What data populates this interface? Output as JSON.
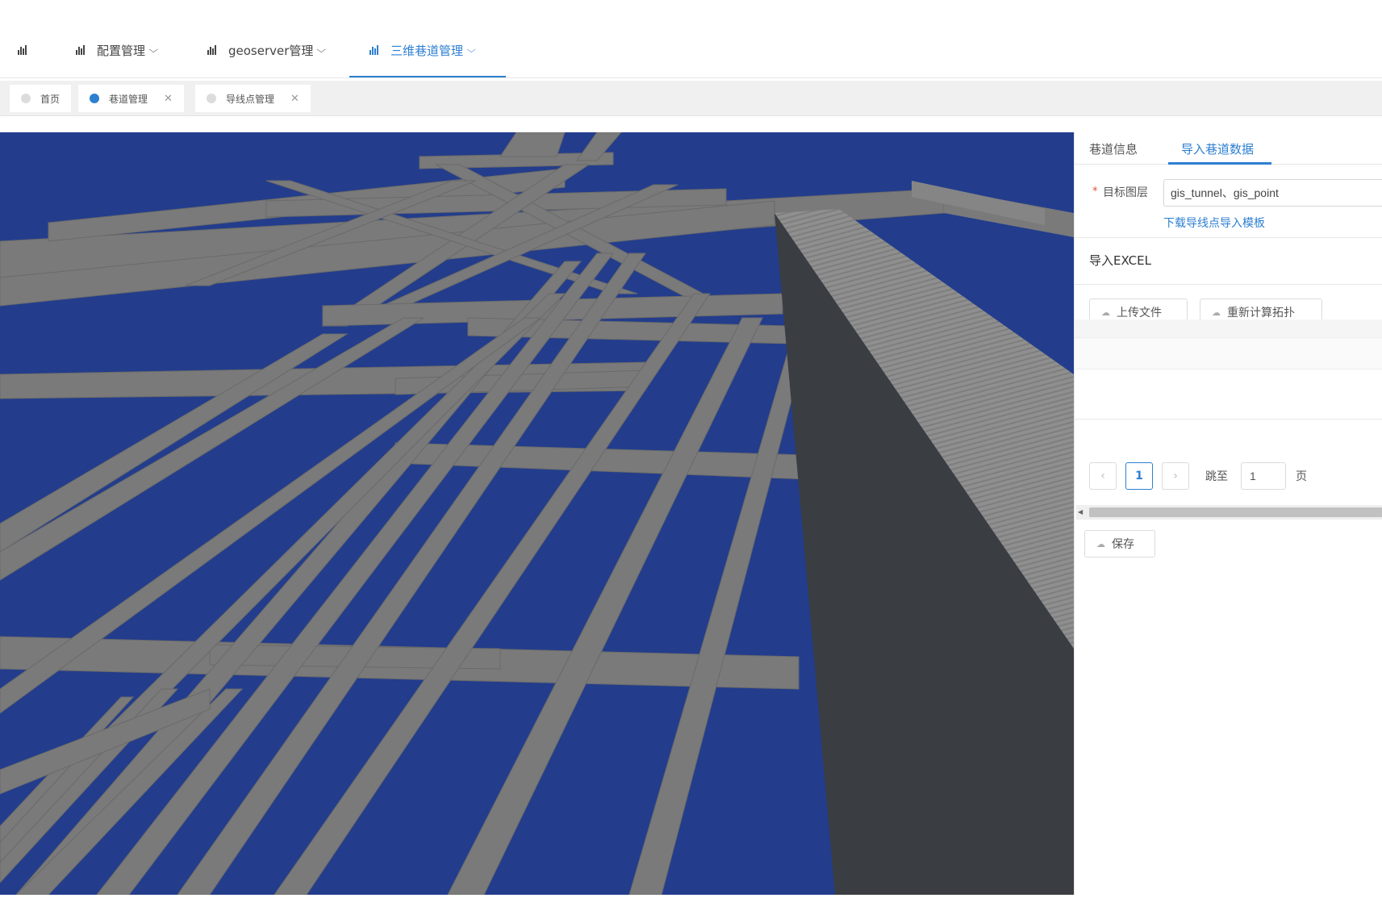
{
  "nav": {
    "items": [
      {
        "label": ""
      },
      {
        "label": "配置管理"
      },
      {
        "label": "geoserver管理"
      },
      {
        "label": "三维巷道管理"
      }
    ]
  },
  "tags": [
    {
      "label": "首页",
      "closable": false
    },
    {
      "label": "巷道管理",
      "closable": true,
      "active": true
    },
    {
      "label": "导线点管理",
      "closable": true
    }
  ],
  "panel": {
    "tabs": [
      {
        "label": "巷道信息"
      },
      {
        "label": "导入巷道数据",
        "active": true
      }
    ],
    "form": {
      "required_mark": "*",
      "label": "目标图层",
      "value": "gis_tunnel、gis_point",
      "download_link": "下载导线点导入模板"
    },
    "excel_section": {
      "title": "导入EXCEL",
      "upload_button": "上传文件",
      "recompute_button": "重新计算拓扑"
    },
    "pagination": {
      "prev": "‹",
      "current_page": "1",
      "next": "›",
      "goto_label": "跳至",
      "goto_value": "1",
      "page_suffix": "页"
    },
    "save_button": "保存"
  },
  "colors": {
    "accent": "#2d7fd0",
    "viewport_bg": "#233d8c",
    "tunnel_grey": "#7b7b7b",
    "shadow_wall": "#3a3d42"
  }
}
